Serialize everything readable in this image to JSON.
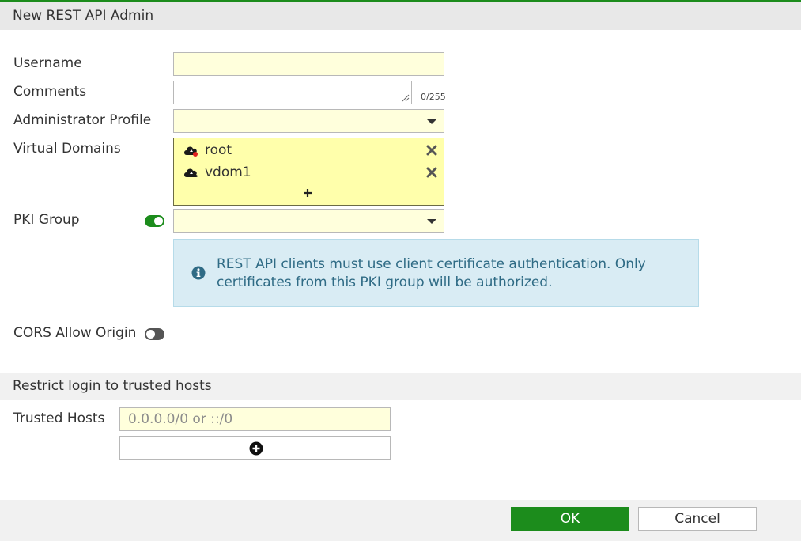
{
  "dialog": {
    "title": "New REST API Admin"
  },
  "form": {
    "username": {
      "label": "Username",
      "value": ""
    },
    "comments": {
      "label": "Comments",
      "value": "",
      "counter": "0/255"
    },
    "admin_profile": {
      "label": "Administrator Profile",
      "value": ""
    },
    "virtual_domains": {
      "label": "Virtual Domains",
      "items": [
        {
          "name": "root",
          "icon": "cloud-icon-with-red-dot"
        },
        {
          "name": "vdom1",
          "icon": "cloud-icon"
        }
      ]
    },
    "pki_group": {
      "label": "PKI Group",
      "enabled": true,
      "value": ""
    },
    "info": {
      "text": "REST API clients must use client certificate authentication. Only certificates from this PKI group will be authorized."
    },
    "cors": {
      "label": "CORS Allow Origin",
      "enabled": false
    }
  },
  "trusted": {
    "section_title": "Restrict login to trusted hosts",
    "hosts_label": "Trusted Hosts",
    "hosts_placeholder": "0.0.0.0/0 or ::/0"
  },
  "buttons": {
    "ok": "OK",
    "cancel": "Cancel"
  },
  "colors": {
    "accent": "#1c8c1c",
    "input_bg": "#ffffdc",
    "vdom_bg": "#ffffab",
    "info_bg": "#d9ecf4",
    "info_text": "#2f6b85"
  }
}
